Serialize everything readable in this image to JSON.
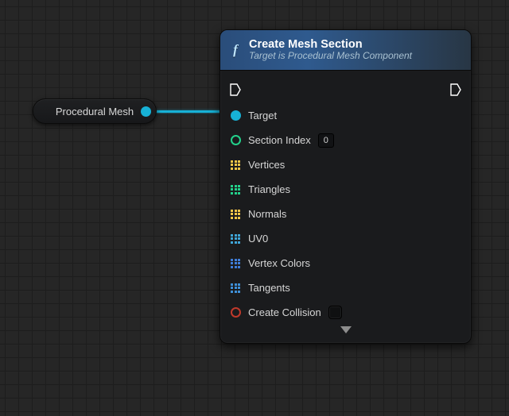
{
  "variable_node": {
    "label": "Procedural Mesh"
  },
  "node": {
    "icon_glyph": "f",
    "title": "Create Mesh Section",
    "subtitle": "Target is Procedural Mesh Component",
    "pins": {
      "target": "Target",
      "section_index": {
        "label": "Section Index",
        "value": "0"
      },
      "vertices": "Vertices",
      "triangles": "Triangles",
      "normals": "Normals",
      "uv0": "UV0",
      "vertex_colors": "Vertex Colors",
      "tangents": "Tangents",
      "create_collision": "Create Collision"
    }
  }
}
